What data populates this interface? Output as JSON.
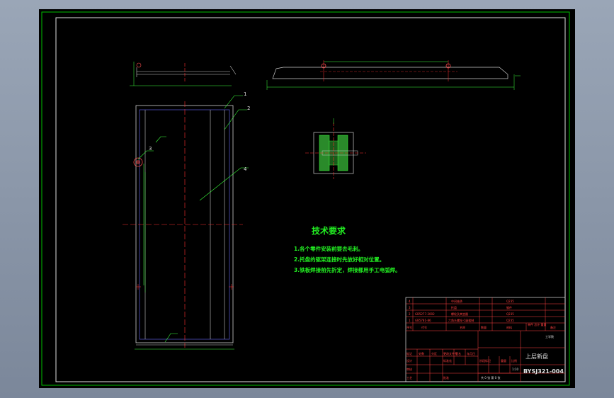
{
  "technical_requirements": {
    "title": "技术要求",
    "items": [
      "1.各个零件安装前要去毛刺。",
      "2.托盘的驱架连接时先放好相对位置。",
      "3.铁板焊接前先折定，焊接都用手工电弧焊。"
    ]
  },
  "part_balloons": [
    "1",
    "2",
    "3",
    "4"
  ],
  "parts_list": {
    "rows": [
      {
        "no": "4",
        "code": "",
        "name": "中间轴承",
        "qty": "",
        "material": "Q235"
      },
      {
        "no": "3",
        "code": "",
        "name": "托盘",
        "qty": "",
        "material": "钢件"
      },
      {
        "no": "2",
        "code": "GB5277-2002",
        "name": "螺栓及其垫圈",
        "qty": "",
        "material": "Q235"
      },
      {
        "no": "1",
        "code": "GB5781-86",
        "name": "六角头螺栓-C级粗制",
        "qty": "",
        "material": "Q235"
      }
    ],
    "header": {
      "no": "序号",
      "code": "代号",
      "name": "名称",
      "qty": "数量",
      "material": "材料",
      "mass": "单件 总计 重量",
      "remark": "备注"
    }
  },
  "title_block": {
    "drawing_name": "上层新盘",
    "drawing_code": "BYSJ321-004",
    "material_mark": "工学院",
    "labels": [
      "标记",
      "处数",
      "分区",
      "更改文件号",
      "签名",
      "年月日",
      "设计",
      "标准化",
      "阶段标记",
      "重量",
      "比例",
      "审核",
      "工艺",
      "批准"
    ],
    "scale": "1:10",
    "sheet": "共 0 张  第 0 张"
  }
}
